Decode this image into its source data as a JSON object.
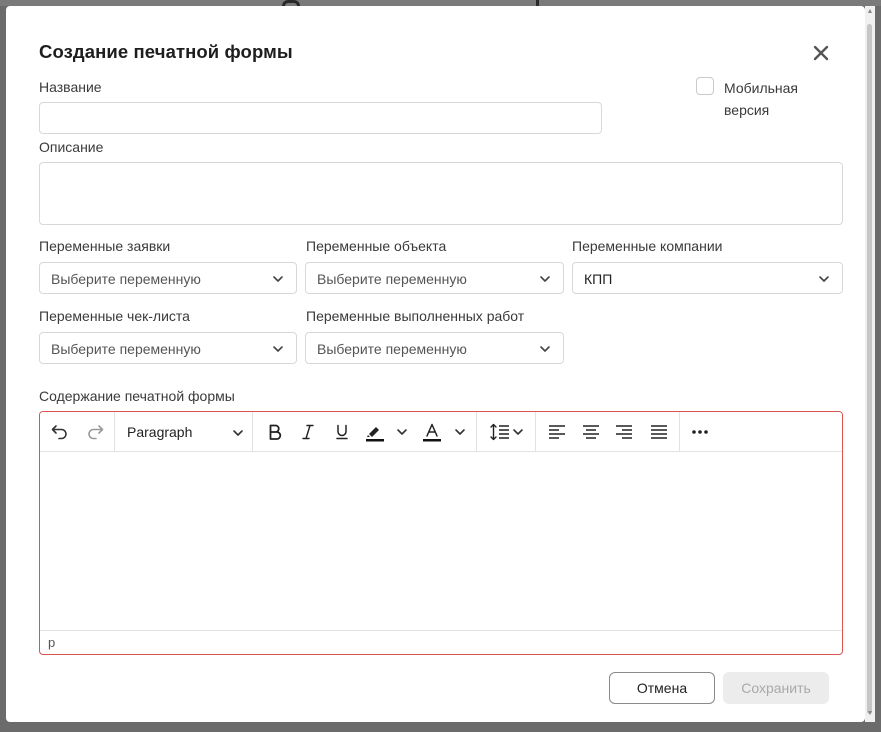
{
  "dialog": {
    "title": "Создание печатной формы"
  },
  "form": {
    "name_label": "Название",
    "name_value": "",
    "mobile_label": "Мобильная версия",
    "mobile_checked": false,
    "description_label": "Описание",
    "description_value": "",
    "vars_request_label": "Переменные заявки",
    "vars_request_value": "Выберите переменную",
    "vars_object_label": "Переменные объекта",
    "vars_object_value": "Выберите переменную",
    "vars_company_label": "Переменные компании",
    "vars_company_value": "КПП",
    "vars_checklist_label": "Переменные чек-листа",
    "vars_checklist_value": "Выберите переменную",
    "vars_works_label": "Переменные выполненных работ",
    "vars_works_value": "Выберите переменную",
    "content_label": "Содержание печатной формы"
  },
  "editor": {
    "block_format": "Paragraph",
    "status_path": "p",
    "tools": [
      "undo-icon",
      "redo-icon",
      "bold-icon",
      "italic-icon",
      "underline-icon",
      "highlight-color-icon",
      "text-color-icon",
      "line-height-icon",
      "align-left-icon",
      "align-center-icon",
      "align-right-icon",
      "align-justify-icon",
      "more-icon"
    ]
  },
  "footer": {
    "cancel_label": "Отмена",
    "save_label": "Сохранить"
  },
  "colors": {
    "editor_border_error": "#d9534f",
    "save_disabled_bg": "#ececec",
    "overlay": "#6b6b6b"
  }
}
